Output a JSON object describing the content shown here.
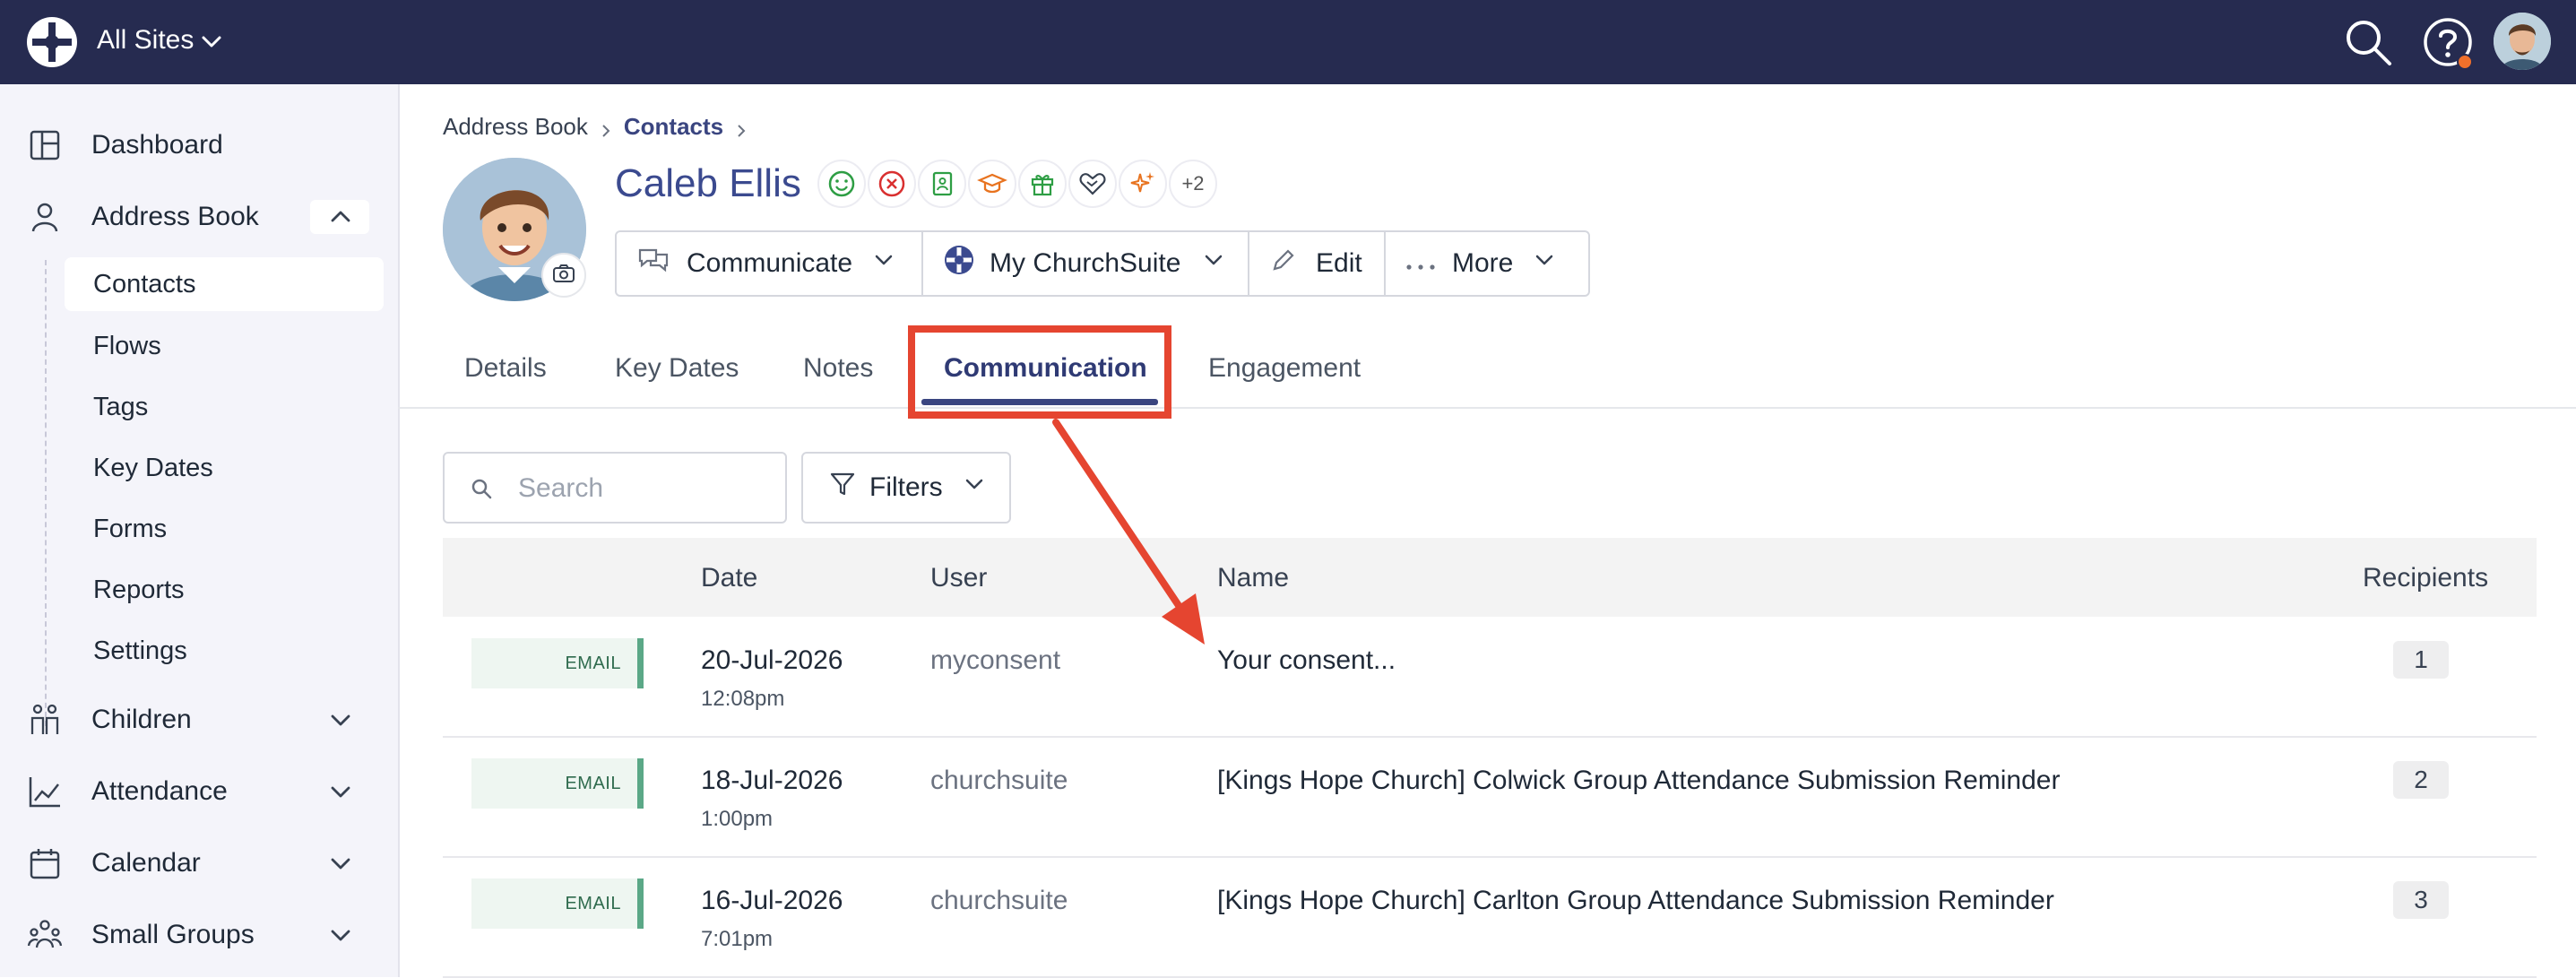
{
  "topbar": {
    "site_label": "All Sites",
    "icons": [
      "churchsuite-logo-icon",
      "chevron-down-icon",
      "search-icon",
      "help-icon",
      "user-avatar"
    ]
  },
  "sidebar": {
    "items": [
      {
        "label": "Dashboard",
        "icon": "dashboard-icon"
      },
      {
        "label": "Address Book",
        "icon": "person-icon"
      },
      {
        "label": "Children",
        "icon": "children-icon"
      },
      {
        "label": "Attendance",
        "icon": "chart-icon"
      },
      {
        "label": "Calendar",
        "icon": "calendar-icon"
      },
      {
        "label": "Small Groups",
        "icon": "group-icon"
      }
    ],
    "sub_items": [
      "Contacts",
      "Flows",
      "Tags",
      "Key Dates",
      "Forms",
      "Reports",
      "Settings"
    ]
  },
  "breadcrumb": {
    "parent": "Address Book",
    "current": "Contacts"
  },
  "contact": {
    "name": "Caleb Ellis",
    "more_tags": "+2",
    "tag_icons": [
      "smile-icon",
      "blocked-icon",
      "contact-card-icon",
      "graduation-cap-icon",
      "gift-icon",
      "heart-handshake-icon",
      "sparkle-icon"
    ]
  },
  "actions": {
    "communicate": "Communicate",
    "mychurchsuite": "My ChurchSuite",
    "edit": "Edit",
    "more": "More"
  },
  "tabs": [
    "Details",
    "Key Dates",
    "Notes",
    "Communication",
    "Engagement"
  ],
  "active_tab": "Communication",
  "toolbar": {
    "search_placeholder": "Search",
    "filters_label": "Filters"
  },
  "table": {
    "headers": {
      "date": "Date",
      "user": "User",
      "name": "Name",
      "recipients": "Recipients"
    },
    "rows": [
      {
        "type": "EMAIL",
        "date": "20-Jul-2026",
        "time": "12:08pm",
        "user": "myconsent",
        "name": "Your consent...",
        "recipients": "1"
      },
      {
        "type": "EMAIL",
        "date": "18-Jul-2026",
        "time": "1:00pm",
        "user": "churchsuite",
        "name": "[Kings Hope Church] Colwick Group Attendance Submission Reminder",
        "recipients": "2"
      },
      {
        "type": "EMAIL",
        "date": "16-Jul-2026",
        "time": "7:01pm",
        "user": "churchsuite",
        "name": "[Kings Hope Church] Carlton Group Attendance Submission Reminder",
        "recipients": "3"
      }
    ]
  },
  "colors": {
    "topbar": "#262b50",
    "accent": "#3a4580",
    "annotation": "#e54530",
    "email_badge": "#5ba887"
  }
}
